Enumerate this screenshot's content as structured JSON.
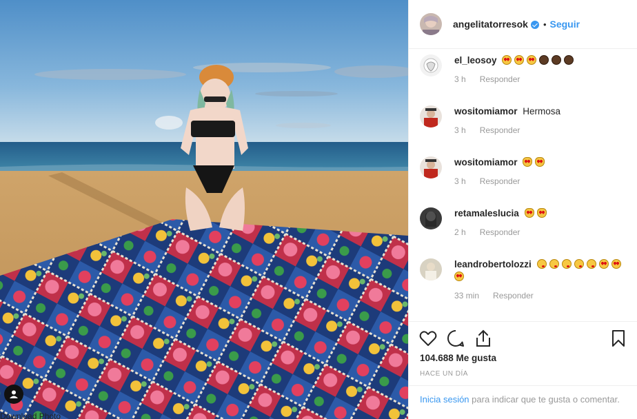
{
  "post": {
    "author": "angelitatorresok",
    "follow_label": "Seguir",
    "separator": "•",
    "download_label": "Download Photo"
  },
  "comments": [
    {
      "user": "el_leosoy",
      "text": "",
      "emojis": [
        "heart-eyes",
        "heart-eyes",
        "heart-eyes",
        "face",
        "face",
        "face"
      ],
      "time": "3 h",
      "reply": "Responder"
    },
    {
      "user": "wositomiamor",
      "text": "Hermosa",
      "emojis": [],
      "time": "3 h",
      "reply": "Responder"
    },
    {
      "user": "wositomiamor",
      "text": "",
      "emojis": [
        "heart-eyes-cat",
        "heart-eyes-cat"
      ],
      "time": "3 h",
      "reply": "Responder"
    },
    {
      "user": "retamaleslucia",
      "text": "",
      "emojis": [
        "heart-eyes-cat",
        "heart-eyes-cat"
      ],
      "time": "2 h",
      "reply": "Responder"
    },
    {
      "user": "leandrobertolozzi",
      "text": "",
      "emojis": [
        "kiss",
        "kiss",
        "kiss",
        "kiss",
        "kiss",
        "heart-eyes",
        "heart-eyes",
        "heart-eyes"
      ],
      "time": "33 min",
      "reply": "Responder"
    }
  ],
  "likes": "104.688 Me gusta",
  "posted": "HACE UN DÍA",
  "login": {
    "link": "Inicia sesión",
    "text": "para indicar que te gusta o comentar."
  },
  "colors": {
    "accent": "#3897f0",
    "muted": "#999999",
    "text": "#262626"
  },
  "icons": [
    "verified-icon",
    "heart-icon",
    "comment-icon",
    "share-icon",
    "bookmark-icon",
    "user-icon"
  ]
}
